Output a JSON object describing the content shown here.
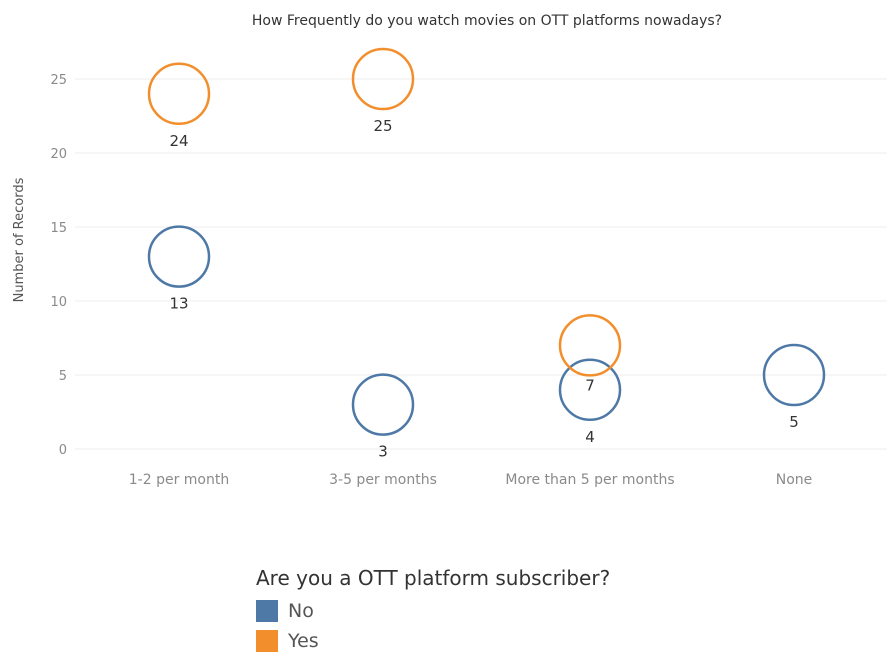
{
  "chart_data": {
    "type": "scatter",
    "title": "How Frequently do you watch movies on OTT platforms nowadays?",
    "ylabel": "Number of Records",
    "xlabel": "",
    "categories": [
      "1-2 per month",
      "3-5 per months",
      "More than 5 per months",
      "None"
    ],
    "y_ticks": [
      "0",
      "5",
      "10",
      "15",
      "20",
      "25"
    ],
    "ylim": [
      0,
      28
    ],
    "grid": true,
    "marker": "open-circle",
    "series": [
      {
        "name": "No",
        "color": "#4e79a7",
        "values": [
          13,
          3,
          4,
          5
        ],
        "labels": [
          "13",
          "3",
          "4",
          "5"
        ]
      },
      {
        "name": "Yes",
        "color": "#f28e2b",
        "values": [
          24,
          25,
          7,
          null
        ],
        "labels": [
          "24",
          "25",
          "7",
          ""
        ]
      }
    ],
    "legend": {
      "title": "Are you a OTT platform subscriber?",
      "placement": "bottom"
    }
  }
}
